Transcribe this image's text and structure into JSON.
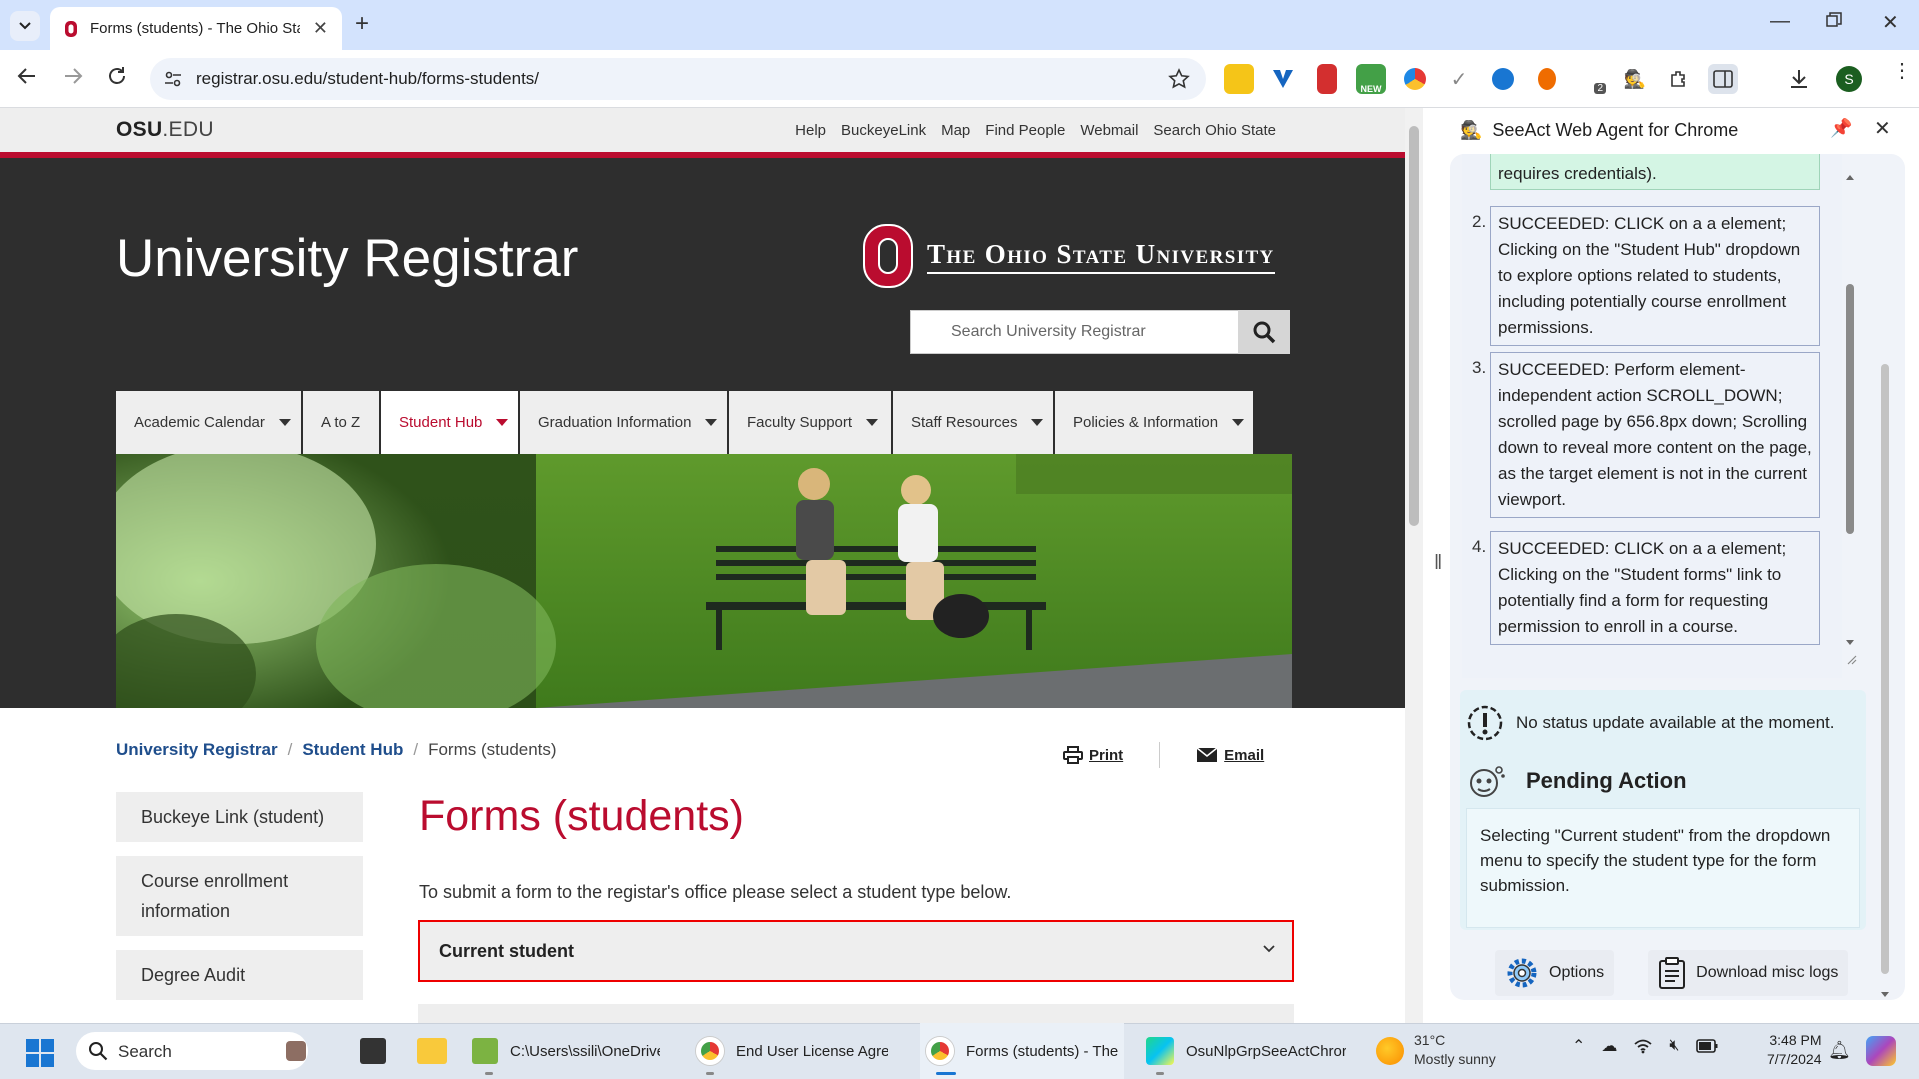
{
  "browser": {
    "tab_title": "Forms (students) - The Ohio State",
    "url": "registrar.osu.edu/student-hub/forms-students/",
    "new_badge": "NEW",
    "ext_badge_count": "2",
    "profile_initial": "S"
  },
  "osu_bar": {
    "logo_bold": "OSU",
    "logo_rest": ".EDU",
    "links": [
      "Help",
      "BuckeyeLink",
      "Map",
      "Find People",
      "Webmail",
      "Search Ohio State"
    ]
  },
  "header": {
    "site_title": "University Registrar",
    "wordmark": "The Ohio State University",
    "search_placeholder": "Search University Registrar"
  },
  "nav": {
    "items": [
      {
        "label": "Academic Calendar"
      },
      {
        "label": "A to Z"
      },
      {
        "label": "Student Hub"
      },
      {
        "label": "Graduation Information"
      },
      {
        "label": "Faculty Support"
      },
      {
        "label": "Staff Resources"
      },
      {
        "label": "Policies & Information"
      }
    ]
  },
  "breadcrumb": {
    "items": [
      "University Registrar",
      "Student Hub",
      "Forms (students)"
    ],
    "sep": "/"
  },
  "actions": {
    "print": "Print",
    "email": "Email"
  },
  "sidenav": {
    "items": [
      "Buckeye Link (student)",
      "Course enrollment information",
      "Degree Audit"
    ]
  },
  "main": {
    "title": "Forms (students)",
    "intro": "To submit a form to the registar's office please select a student type below.",
    "student_type_selected": "Current student"
  },
  "panel": {
    "title": "SeeAct Web Agent for Chrome",
    "log_partial": "requires credentials).",
    "logs": [
      {
        "n": "2.",
        "text": "SUCCEEDED: CLICK on a a element; Clicking on the \"Student Hub\" dropdown to explore options related to students, including potentially course enrollment permissions."
      },
      {
        "n": "3.",
        "text": "SUCCEEDED: Perform element-independent action SCROLL_DOWN; scrolled page by 656.8px down; Scrolling down to reveal more content on the page, as the target element is not in the current viewport."
      },
      {
        "n": "4.",
        "text": "SUCCEEDED: CLICK on a a element; Clicking on the \"Student forms\" link to potentially find a form for requesting permission to enroll in a course."
      }
    ],
    "status": "No status update available at the moment.",
    "pending_heading": "Pending Action",
    "pending_text": "Selecting \"Current student\" from the dropdown menu to specify the student type for the form submission.",
    "btn_options": "Options",
    "btn_download": "Download misc logs"
  },
  "taskbar": {
    "search": "Search",
    "items": [
      {
        "label": "C:\\Users\\ssili\\OneDrive\\"
      },
      {
        "label": "End User License Agreem"
      },
      {
        "label": "Forms (students) - The O"
      },
      {
        "label": "OsuNlpGrpSeeActChror"
      }
    ],
    "weather_temp": "31°C",
    "weather_desc": "Mostly sunny",
    "time": "3:48 PM",
    "date": "7/7/2024"
  },
  "colors": {
    "osu_scarlet": "#ba0c2f",
    "link_blue": "#1f4e8c",
    "chrome_tab_bg": "#d3e3fd",
    "highlight_red": "#ff0000"
  }
}
